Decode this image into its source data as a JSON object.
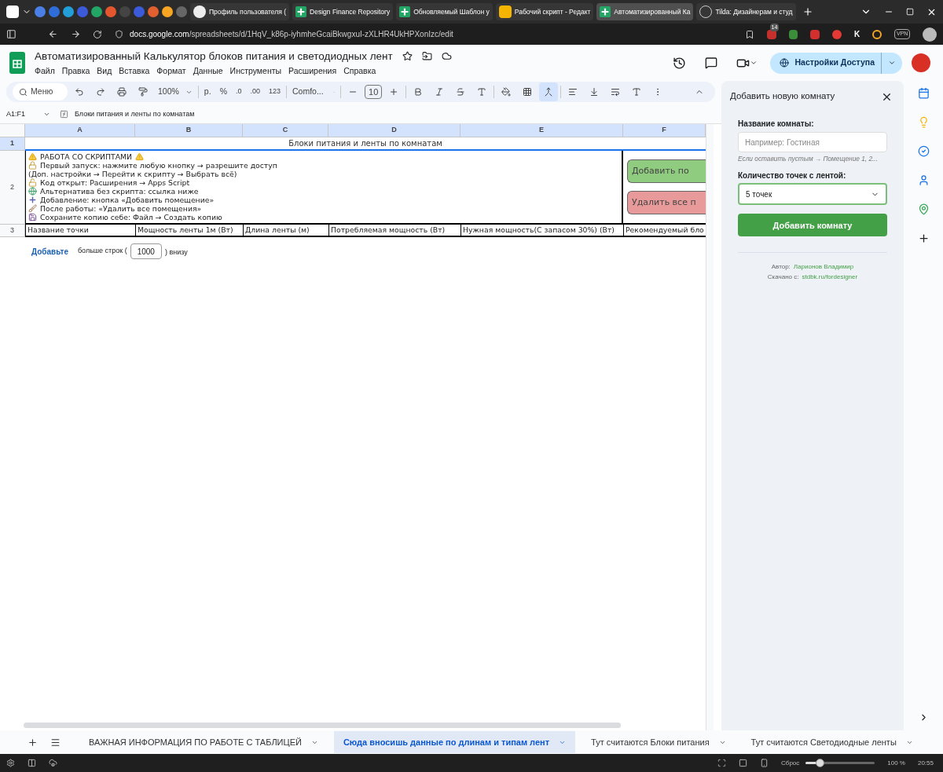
{
  "browser": {
    "tabs": [
      {
        "title": "Профиль пользователя (",
        "kind": "profile",
        "selected": false
      },
      {
        "title": "Design Finance Repository",
        "kind": "sheets",
        "selected": false
      },
      {
        "title": "Обновляемый Шаблон у",
        "kind": "sheets",
        "selected": false
      },
      {
        "title": "Рабочий скрипт - Редакт",
        "kind": "script",
        "selected": false
      },
      {
        "title": "Автоматизированный Ка",
        "kind": "sheets",
        "selected": true
      },
      {
        "title": "Tilda: Дизайнерам и студ",
        "kind": "help",
        "selected": false
      }
    ],
    "address": {
      "host": "docs.google.com",
      "path": "/spreadsheets/d/1HqV_k86p-iyhmheGcaiBkwgxuI-zXLHR4UkHPXonIzc/edit"
    },
    "extension_badge": "14",
    "extension_letter": "K",
    "vpn": "VPN"
  },
  "document": {
    "title": "Автоматизированный Калькулятор блоков питания и светодиодных лент",
    "menu": [
      "Файл",
      "Правка",
      "Вид",
      "Вставка",
      "Формат",
      "Данные",
      "Инструменты",
      "Расширения",
      "Справка"
    ],
    "share_button": "Настройки Доступа"
  },
  "toolbar": {
    "search": "Меню",
    "zoom": "100%",
    "currency": "р.",
    "percent": "%",
    "decimal_less": ".0",
    "decimal_more": ".00",
    "format": "123",
    "font": "Comfo...",
    "font_size": "10"
  },
  "formula_bar": {
    "range": "A1:F1",
    "value": "Блоки питания и ленты по комнатам"
  },
  "grid": {
    "columns": [
      {
        "label": "A",
        "selected": true
      },
      {
        "label": "B",
        "selected": true
      },
      {
        "label": "C",
        "selected": true
      },
      {
        "label": "D",
        "selected": true
      },
      {
        "label": "E",
        "selected": true
      },
      {
        "label": "F",
        "selected": true
      }
    ],
    "rows": [
      {
        "number": "1",
        "selected": true
      },
      {
        "number": "2",
        "selected": false
      },
      {
        "number": "3",
        "selected": false
      }
    ],
    "title": "Блоки питания и ленты по комнатам",
    "notes": [
      {
        "text": "РАБОТА СО СКРИПТАМИ",
        "kind": "heading"
      },
      {
        "text": "Первый запуск: нажмите любую кнопку → разрешите доступ",
        "kind": "lock"
      },
      {
        "text": "(Доп. настройки → Перейти к скрипту → Выбрать всё)",
        "kind": "plain"
      },
      {
        "text": "Код открыт: Расширения → Apps Script",
        "kind": "unlock"
      },
      {
        "text": "Альтернатива без скрипта: ссылка ниже",
        "kind": "globe"
      },
      {
        "text": "Добавление: кнопка «Добавить помещение»",
        "kind": "plus"
      },
      {
        "text": "После работы: «Удалить все помещения»",
        "kind": "broom"
      },
      {
        "text": "Сохраните копию себе: Файл → Создать копию",
        "kind": "floppy"
      }
    ],
    "buttons": [
      {
        "label": "Добавить по",
        "kind": "add"
      },
      {
        "label": "Удалить все п",
        "kind": "delete"
      }
    ],
    "headers": [
      "Название точки",
      "Мощность ленты 1м (Вт)",
      "Длина ленты (м)",
      "Потребляемая мощность  (Вт)",
      "Нужная мощность(С запасом 30%)  (Вт)",
      "Рекомендуемый бло"
    ],
    "add_rows": {
      "link": "Добавьте",
      "before": "больше строк (",
      "value": "1000",
      "after": ") внизу"
    }
  },
  "side_panel": {
    "title": "Добавить новую комнату",
    "name_label": "Название комнаты:",
    "name_placeholder": "Например: Гостиная",
    "name_hint": "Если оставить пустым → Помещение 1, 2...",
    "count_label": "Количество точек с лентой:",
    "count_value": "5 точек",
    "submit": "Добавить комнату",
    "author_label": "Автор:",
    "author": "Ларионов Владимир",
    "source_label": "Скачано с:",
    "source": "stdbk.ru/fordesigner"
  },
  "sheet_tabs": [
    {
      "label": "ВАЖНАЯ ИНФОРМАЦИЯ ПО РАБОТЕ С ТАБЛИЦЕЙ",
      "selected": false
    },
    {
      "label": "Сюда вносишь данные по длинам и типам лент",
      "selected": true
    },
    {
      "label": "Тут считаются Блоки питания",
      "selected": false
    },
    {
      "label": "Тут считаются Светодиодные ленты",
      "selected": false
    }
  ],
  "status_bar": {
    "reset": "Сброс",
    "zoom": {
      "level": 0.2
    },
    "zoom_text": "100 %",
    "time": "20:55"
  }
}
